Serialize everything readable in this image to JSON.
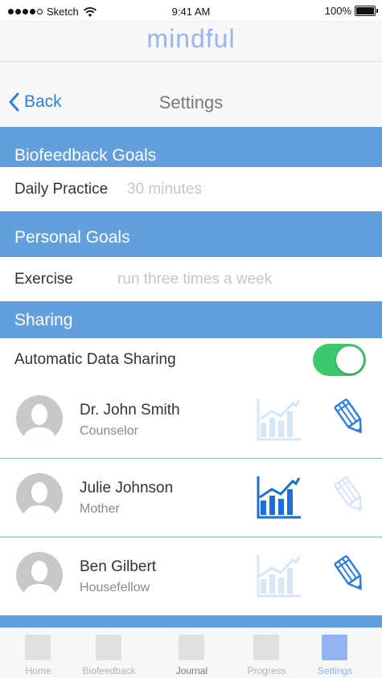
{
  "status_bar": {
    "carrier": "Sketch",
    "time": "9:41 AM",
    "battery": "100%"
  },
  "app": {
    "title": "mindful"
  },
  "nav": {
    "back_label": "Back",
    "title": "Settings"
  },
  "sections": {
    "biofeedback_goals": "Biofeedback Goals",
    "personal_goals": "Personal Goals",
    "sharing": "Sharing"
  },
  "goals": {
    "daily_practice_label": "Daily Practice",
    "daily_practice_value": "30 minutes",
    "exercise_label": "Exercise",
    "exercise_value": "run three times a week"
  },
  "sharing": {
    "auto_label": "Automatic Data Sharing",
    "auto_enabled": true,
    "contacts": [
      {
        "name": "Dr. John Smith",
        "role": "Counselor",
        "chart_active": false,
        "edit_active": true
      },
      {
        "name": "Julie Johnson",
        "role": "Mother",
        "chart_active": true,
        "edit_active": false
      },
      {
        "name": "Ben Gilbert",
        "role": "Housefellow",
        "chart_active": false,
        "edit_active": true
      }
    ]
  },
  "tabs": [
    {
      "label": "Home"
    },
    {
      "label": "Biofeedback"
    },
    {
      "label": "Journal"
    },
    {
      "label": "Progress"
    },
    {
      "label": "Settings"
    }
  ],
  "colors": {
    "accent_blue": "#2d7fe4",
    "section_blue": "#629fdc",
    "toggle_green": "#3cc96d",
    "title_blue": "#9bb3f0",
    "active_tab": "#8fb4f1"
  }
}
